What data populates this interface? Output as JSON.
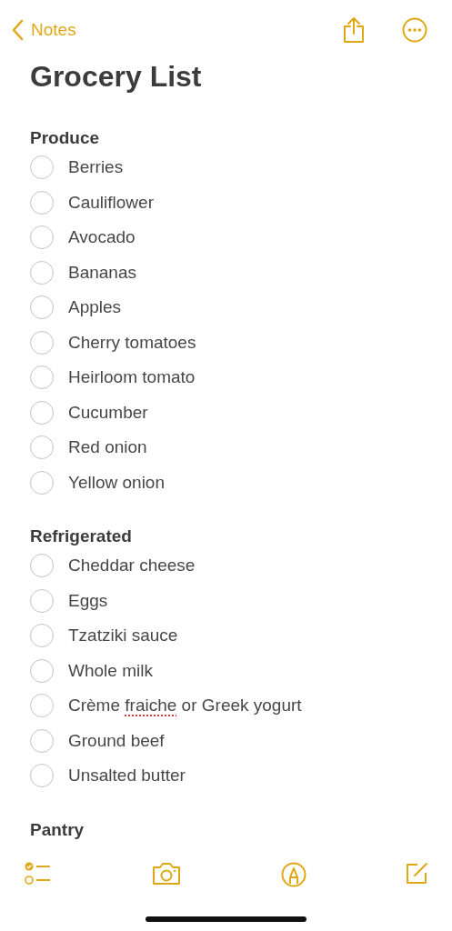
{
  "nav": {
    "back_label": "Notes"
  },
  "title": "Grocery List",
  "sections": [
    {
      "heading": "Produce",
      "items": [
        {
          "parts": [
            {
              "text": "Berries"
            }
          ],
          "checked": false
        },
        {
          "parts": [
            {
              "text": "Cauliflower"
            }
          ],
          "checked": false
        },
        {
          "parts": [
            {
              "text": "Avocado"
            }
          ],
          "checked": false
        },
        {
          "parts": [
            {
              "text": "Bananas"
            }
          ],
          "checked": false
        },
        {
          "parts": [
            {
              "text": "Apples"
            }
          ],
          "checked": false
        },
        {
          "parts": [
            {
              "text": "Cherry tomatoes"
            }
          ],
          "checked": false
        },
        {
          "parts": [
            {
              "text": "Heirloom tomato"
            }
          ],
          "checked": false
        },
        {
          "parts": [
            {
              "text": "Cucumber"
            }
          ],
          "checked": false
        },
        {
          "parts": [
            {
              "text": "Red onion"
            }
          ],
          "checked": false
        },
        {
          "parts": [
            {
              "text": "Yellow onion"
            }
          ],
          "checked": false
        }
      ]
    },
    {
      "heading": "Refrigerated",
      "items": [
        {
          "parts": [
            {
              "text": "Cheddar cheese"
            }
          ],
          "checked": false
        },
        {
          "parts": [
            {
              "text": "Eggs"
            }
          ],
          "checked": false
        },
        {
          "parts": [
            {
              "text": "Tzatziki sauce"
            }
          ],
          "checked": false
        },
        {
          "parts": [
            {
              "text": "Whole milk"
            }
          ],
          "checked": false
        },
        {
          "parts": [
            {
              "text": "Crème "
            },
            {
              "text": "fraiche",
              "misspelled": true
            },
            {
              "text": " or Greek yogurt"
            }
          ],
          "checked": false
        },
        {
          "parts": [
            {
              "text": "Ground beef"
            }
          ],
          "checked": false
        },
        {
          "parts": [
            {
              "text": "Unsalted butter"
            }
          ],
          "checked": false
        }
      ]
    },
    {
      "heading": "Pantry"
    }
  ]
}
